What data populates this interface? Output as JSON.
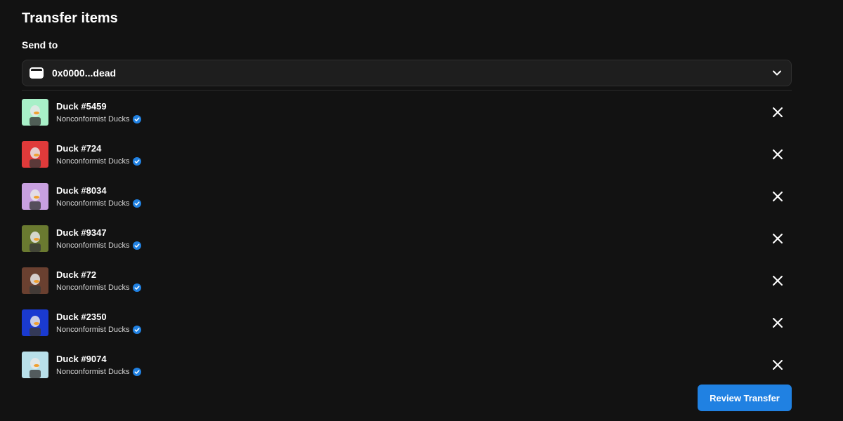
{
  "header": {
    "title": "Transfer items"
  },
  "recipient": {
    "label": "Send to",
    "value": "0x0000...dead",
    "icon": "wallet-icon",
    "dropdown_icon": "chevron-down-icon"
  },
  "items": [
    {
      "name": "Duck #5459",
      "collection": "Nonconformist Ducks",
      "verified": true,
      "bg": "#a8f0c8"
    },
    {
      "name": "Duck #724",
      "collection": "Nonconformist Ducks",
      "verified": true,
      "bg": "#e03a3a"
    },
    {
      "name": "Duck #8034",
      "collection": "Nonconformist Ducks",
      "verified": true,
      "bg": "#c8a0e0"
    },
    {
      "name": "Duck #9347",
      "collection": "Nonconformist Ducks",
      "verified": true,
      "bg": "#6a7a30"
    },
    {
      "name": "Duck #72",
      "collection": "Nonconformist Ducks",
      "verified": true,
      "bg": "#6a4030"
    },
    {
      "name": "Duck #2350",
      "collection": "Nonconformist Ducks",
      "verified": true,
      "bg": "#1a3ad0"
    },
    {
      "name": "Duck #9074",
      "collection": "Nonconformist Ducks",
      "verified": true,
      "bg": "#b8e0ea"
    }
  ],
  "footer": {
    "review_label": "Review Transfer"
  },
  "colors": {
    "background": "#121212",
    "accent": "#2081e2",
    "verified": "#2081e2"
  }
}
